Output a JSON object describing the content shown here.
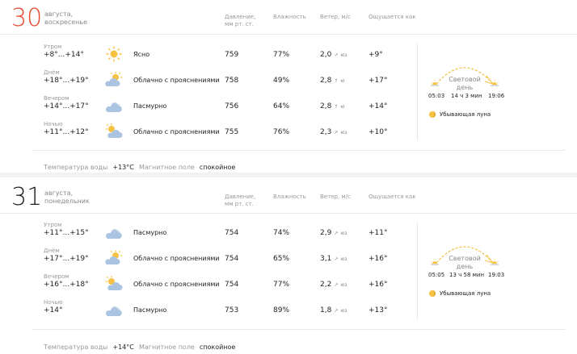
{
  "headers": {
    "pressure_line1": "Давление,",
    "pressure_line2": "мм рт. ст.",
    "humidity": "Влажность",
    "wind": "Ветер, м/с",
    "feels": "Ощущается как"
  },
  "days": [
    {
      "number": "30",
      "month": "августа,",
      "weekday": "воскресенье",
      "rows": [
        {
          "period": "Утром",
          "temp": "+8°...+14°",
          "condition": "Ясно",
          "icon": "sun-icon",
          "pressure": "759",
          "humidity": "77%",
          "wind": "2,0",
          "wind_dir": "юз",
          "feels": "+9°"
        },
        {
          "period": "Днём",
          "temp": "+18°...+19°",
          "condition": "Облачно с прояснениями",
          "icon": "partly-cloudy-icon",
          "pressure": "758",
          "humidity": "49%",
          "wind": "2,8",
          "wind_dir": "ю",
          "feels": "+17°"
        },
        {
          "period": "Вечером",
          "temp": "+14°...+17°",
          "condition": "Пасмурно",
          "icon": "cloud-icon",
          "pressure": "756",
          "humidity": "64%",
          "wind": "2,8",
          "wind_dir": "ю",
          "feels": "+14°"
        },
        {
          "period": "Ночью",
          "temp": "+11°...+12°",
          "condition": "Облачно с прояснениями",
          "icon": "partly-cloudy-icon",
          "pressure": "755",
          "humidity": "76%",
          "wind": "2,3",
          "wind_dir": "юз",
          "feels": "+10°"
        }
      ],
      "footer": {
        "water_label": "Температура воды",
        "water_value": "+13°C",
        "magnetic_label": "Магнитное поле",
        "magnetic_value": "спокойное"
      },
      "sun": {
        "day_line1": "Световой",
        "day_line2": "день",
        "sunrise": "05:03",
        "duration": "14 ч 3 мин",
        "sunset": "19:06",
        "moon": "Убывающая луна"
      }
    },
    {
      "number": "31",
      "month": "августа,",
      "weekday": "понедельник",
      "rows": [
        {
          "period": "Утром",
          "temp": "+11°...+15°",
          "condition": "Пасмурно",
          "icon": "cloud-icon",
          "pressure": "754",
          "humidity": "74%",
          "wind": "2,9",
          "wind_dir": "юз",
          "feels": "+11°"
        },
        {
          "period": "Днём",
          "temp": "+17°...+19°",
          "condition": "Облачно с прояснениями",
          "icon": "partly-cloudy-icon",
          "pressure": "754",
          "humidity": "65%",
          "wind": "3,1",
          "wind_dir": "юз",
          "feels": "+16°"
        },
        {
          "period": "Вечером",
          "temp": "+16°...+18°",
          "condition": "Облачно с прояснениями",
          "icon": "partly-cloudy-icon",
          "pressure": "754",
          "humidity": "77%",
          "wind": "2,2",
          "wind_dir": "юз",
          "feels": "+16°"
        },
        {
          "period": "Ночью",
          "temp": "+14°",
          "condition": "Пасмурно",
          "icon": "cloud-icon",
          "pressure": "753",
          "humidity": "89%",
          "wind": "1,8",
          "wind_dir": "юз",
          "feels": "+13°"
        }
      ],
      "footer": {
        "water_label": "Температура воды",
        "water_value": "+14°C",
        "magnetic_label": "Магнитное поле",
        "magnetic_value": "спокойное"
      },
      "sun": {
        "day_line1": "Световой",
        "day_line2": "день",
        "sunrise": "05:05",
        "duration": "13 ч 58 мин",
        "sunset": "19:03",
        "moon": "Убывающая луна"
      }
    }
  ],
  "colors": {
    "accent_red": "#e8482d",
    "sun_yellow": "#f5c242",
    "cloud_blue": "#a9c3e0"
  }
}
